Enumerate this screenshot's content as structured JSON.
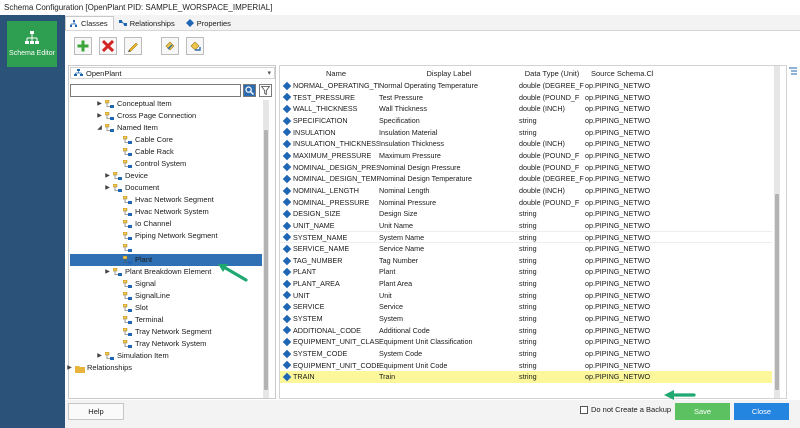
{
  "window": {
    "title": "Schema Configuration [OpenPlant PID: SAMPLE_WORSPACE_IMPERIAL]"
  },
  "left_panel": {
    "schema_editor_label": "Schema Editor"
  },
  "tabs": [
    {
      "label": "Classes",
      "active": true
    },
    {
      "label": "Relationships",
      "active": false
    },
    {
      "label": "Properties",
      "active": false
    }
  ],
  "toolbar": {
    "icons": [
      "add-icon",
      "delete-icon",
      "edit-icon",
      "copy-icon",
      "paste-icon"
    ]
  },
  "tree": {
    "root_combo": "OpenPlant",
    "search_value": "",
    "nodes": [
      {
        "label": "Conceptual Item",
        "expander": "▶"
      },
      {
        "label": "Cross Page Connection",
        "expander": "▶"
      },
      {
        "label": "Named Item",
        "expander": "◢"
      },
      {
        "label": "Cable Core",
        "expander": ""
      },
      {
        "label": "Cable Rack",
        "expander": ""
      },
      {
        "label": "Control System",
        "expander": ""
      },
      {
        "label": "Device",
        "expander": "▶"
      },
      {
        "label": "Document",
        "expander": "▶"
      },
      {
        "label": "Hvac Network Segment",
        "expander": ""
      },
      {
        "label": "Hvac Network System",
        "expander": ""
      },
      {
        "label": "Io Channel",
        "expander": ""
      },
      {
        "label": "Piping Network Segment",
        "expander": ""
      },
      {
        "label": "Piping Network System",
        "expander": "",
        "selected": true
      },
      {
        "label": "Plant",
        "expander": ""
      },
      {
        "label": "Plant Breakdown Element",
        "expander": "▶"
      },
      {
        "label": "Signal",
        "expander": ""
      },
      {
        "label": "SignalLine",
        "expander": ""
      },
      {
        "label": "Slot",
        "expander": ""
      },
      {
        "label": "Terminal",
        "expander": ""
      },
      {
        "label": "Tray Network Segment",
        "expander": ""
      },
      {
        "label": "Tray Network System",
        "expander": ""
      },
      {
        "label": "Simulation Item",
        "expander": "▶"
      },
      {
        "label": "Relationships",
        "expander": "▶"
      }
    ]
  },
  "grid": {
    "columns": [
      "Name",
      "Display Label",
      "Data Type (Unit)",
      "Source Schema.Cl"
    ],
    "rows": [
      [
        "NORMAL_OPERATING_TE",
        "Normal Operating Temperature",
        "double (DEGREE_F",
        "op.PIPING_NETWO"
      ],
      [
        "TEST_PRESSURE",
        "Test Pressure",
        "double (POUND_F",
        "op.PIPING_NETWO"
      ],
      [
        "WALL_THICKNESS",
        "Wall Thickness",
        "double (INCH)",
        "op.PIPING_NETWO"
      ],
      [
        "SPECIFICATION",
        "Specification",
        "string",
        "op.PIPING_NETWO"
      ],
      [
        "INSULATION",
        "Insulation Material",
        "string",
        "op.PIPING_NETWO"
      ],
      [
        "INSULATION_THICKNESS",
        "Insulation Thickness",
        "double (INCH)",
        "op.PIPING_NETWO"
      ],
      [
        "MAXIMUM_PRESSURE",
        "Maximum Pressure",
        "double (POUND_F",
        "op.PIPING_NETWO"
      ],
      [
        "NOMINAL_DESIGN_PRES",
        "Nominal Design Pressure",
        "double (POUND_F",
        "op.PIPING_NETWO"
      ],
      [
        "NOMINAL_DESIGN_TEMP",
        "Nominal Design Temperature",
        "double (DEGREE_F",
        "op.PIPING_NETWO"
      ],
      [
        "NOMINAL_LENGTH",
        "Nominal Length",
        "double (INCH)",
        "op.PIPING_NETWO"
      ],
      [
        "NOMINAL_PRESSURE",
        "Nominal Pressure",
        "double (POUND_F",
        "op.PIPING_NETWO"
      ],
      [
        "DESIGN_SIZE",
        "Design Size",
        "string",
        "op.PIPING_NETWO"
      ],
      [
        "UNIT_NAME",
        "Unit Name",
        "string",
        "op.PIPING_NETWO"
      ],
      [
        "SYSTEM_NAME",
        "System Name",
        "string",
        "op.PIPING_NETWO"
      ],
      [
        "SERVICE_NAME",
        "Service Name",
        "string",
        "op.PIPING_NETWO"
      ],
      [
        "TAG_NUMBER",
        "Tag Number",
        "string",
        "op.PIPING_NETWO"
      ],
      [
        "PLANT",
        "Plant",
        "string",
        "op.PIPING_NETWO"
      ],
      [
        "PLANT_AREA",
        "Plant Area",
        "string",
        "op.PIPING_NETWO"
      ],
      [
        "UNIT",
        "Unit",
        "string",
        "op.PIPING_NETWO"
      ],
      [
        "SERVICE",
        "Service",
        "string",
        "op.PIPING_NETWO"
      ],
      [
        "SYSTEM",
        "System",
        "string",
        "op.PIPING_NETWO"
      ],
      [
        "ADDITIONAL_CODE",
        "Additional Code",
        "string",
        "op.PIPING_NETWO"
      ],
      [
        "EQUIPMENT_UNIT_CLASS",
        "Equipment Unit Classification",
        "string",
        "op.PIPING_NETWO"
      ],
      [
        "SYSTEM_CODE",
        "System Code",
        "string",
        "op.PIPING_NETWO"
      ],
      [
        "EQUIPMENT_UNIT_CODE",
        "Equipment Unit Code",
        "string",
        "op.PIPING_NETWO"
      ],
      [
        "TRAIN",
        "Train",
        "string",
        "op.PIPING_NETWO"
      ]
    ],
    "highlighted_row": "TRAIN",
    "highlight_color": "#fbf79a"
  },
  "footer": {
    "help_label": "Help",
    "checkbox_label": "Do not Create a Backup",
    "checkbox_checked": false,
    "save_label": "Save",
    "close_label": "Close"
  },
  "colors": {
    "left_panel": "#2b5279",
    "schema_editor": "#2e9e50",
    "selection": "#2f6fb3",
    "annotation_arrow": "#1fa870",
    "save": "#5cc160",
    "close": "#2385e0"
  }
}
